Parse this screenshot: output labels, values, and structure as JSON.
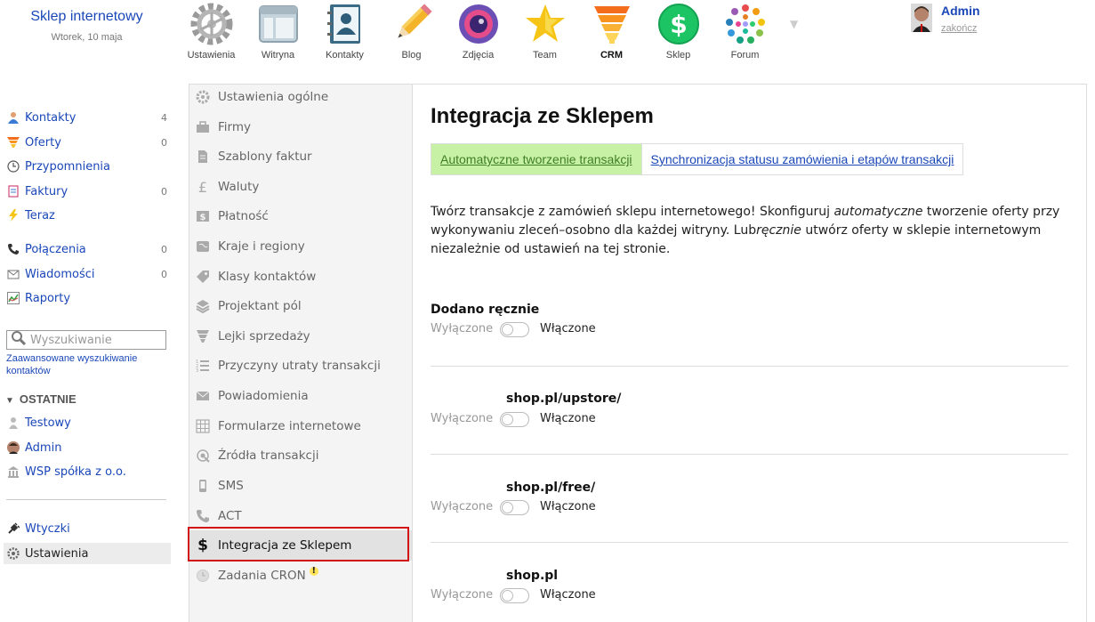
{
  "brand": {
    "name": "Sklep internetowy",
    "date": "Wtorek, 10 maja"
  },
  "apps": [
    {
      "label": "Ustawienia",
      "icon": "gear-icon"
    },
    {
      "label": "Witryna",
      "icon": "window-icon"
    },
    {
      "label": "Kontakty",
      "icon": "address-book-icon"
    },
    {
      "label": "Blog",
      "icon": "pencil-icon"
    },
    {
      "label": "Zdjęcia",
      "icon": "camera-lens-icon"
    },
    {
      "label": "Team",
      "icon": "star-person-icon"
    },
    {
      "label": "CRM",
      "icon": "funnel-icon"
    },
    {
      "label": "Sklep",
      "icon": "dollar-icon"
    },
    {
      "label": "Forum",
      "icon": "dots-circle-icon"
    }
  ],
  "user": {
    "name": "Admin",
    "logout": "zakończ"
  },
  "leftnav": {
    "items": [
      {
        "label": "Kontakty",
        "count": "4",
        "icon": "contact-icon"
      },
      {
        "label": "Oferty",
        "count": "0",
        "icon": "funnel-icon"
      },
      {
        "label": "Przypomnienia",
        "count": "",
        "icon": "clock-icon"
      },
      {
        "label": "Faktury",
        "count": "0",
        "icon": "invoice-icon"
      },
      {
        "label": "Teraz",
        "count": "",
        "icon": "lightning-icon"
      },
      {
        "label": "Połączenia",
        "count": "0",
        "icon": "phone-icon"
      },
      {
        "label": "Wiadomości",
        "count": "0",
        "icon": "envelope-icon"
      },
      {
        "label": "Raporty",
        "count": "",
        "icon": "chart-icon"
      }
    ],
    "search_placeholder": "Wyszukiwanie",
    "advanced_search": "Zaawansowane wyszukiwanie kontaktów",
    "recent_header": "OSTATNIE",
    "recent": [
      {
        "label": "Testowy",
        "icon": "person-icon"
      },
      {
        "label": "Admin",
        "icon": "avatar-icon"
      },
      {
        "label": "WSP spółka z o.o.",
        "icon": "building-icon"
      }
    ],
    "bottom": [
      {
        "label": "Wtyczki",
        "icon": "plug-icon"
      },
      {
        "label": "Ustawienia",
        "icon": "gear-icon"
      }
    ]
  },
  "settings_menu": [
    {
      "label": "Ustawienia ogólne",
      "icon": "gear-icon"
    },
    {
      "label": "Firmy",
      "icon": "briefcase-icon"
    },
    {
      "label": "Szablony faktur",
      "icon": "document-icon"
    },
    {
      "label": "Waluty",
      "icon": "pound-icon"
    },
    {
      "label": "Płatność",
      "icon": "payment-icon"
    },
    {
      "label": "Kraje i regiony",
      "icon": "map-icon"
    },
    {
      "label": "Klasy kontaktów",
      "icon": "tag-icon"
    },
    {
      "label": "Projektant pól",
      "icon": "layers-icon"
    },
    {
      "label": "Lejki sprzedaży",
      "icon": "funnel-icon"
    },
    {
      "label": "Przyczyny utraty transakcji",
      "icon": "list-icon"
    },
    {
      "label": "Powiadomienia",
      "icon": "envelope-icon"
    },
    {
      "label": "Formularze internetowe",
      "icon": "grid-icon"
    },
    {
      "label": "Źródła transakcji",
      "icon": "source-icon"
    },
    {
      "label": "SMS",
      "icon": "mobile-icon"
    },
    {
      "label": "ACT",
      "icon": "phone-icon"
    },
    {
      "label": "Integracja ze Sklepem",
      "icon": "dollar-icon"
    },
    {
      "label": "Zadania CRON",
      "icon": "clock-icon",
      "badge": "!"
    }
  ],
  "main": {
    "title": "Integracja ze Sklepem",
    "tabs": [
      {
        "label": "Automatyczne tworzenie transakcji"
      },
      {
        "label": "Synchronizacja statusu zamówienia i etapów transakcji"
      }
    ],
    "intro_parts": {
      "p1": "Twórz transakcje z zamówień sklepu internetowego! Skonfiguruj ",
      "p1_em": "automatyczne",
      "p2": " tworzenie oferty przy wykonywaniu zleceń–osobno dla każdej witryny. Lub",
      "p2_em": "ręcznie",
      "p3": " utwórz oferty w sklepie internetowym niezależnie od ustawień na tej stronie."
    },
    "toggles": [
      {
        "title": "Dodano ręcznie",
        "off": "Wyłączone",
        "on": "Włączone",
        "enabled": false
      },
      {
        "title": "shop.pl/upstore/",
        "off": "Wyłączone",
        "on": "Włączone",
        "enabled": false
      },
      {
        "title": "shop.pl/free/",
        "off": "Wyłączone",
        "on": "Włączone",
        "enabled": false
      },
      {
        "title": "shop.pl",
        "off": "Wyłączone",
        "on": "Włączone",
        "enabled": false
      }
    ]
  }
}
